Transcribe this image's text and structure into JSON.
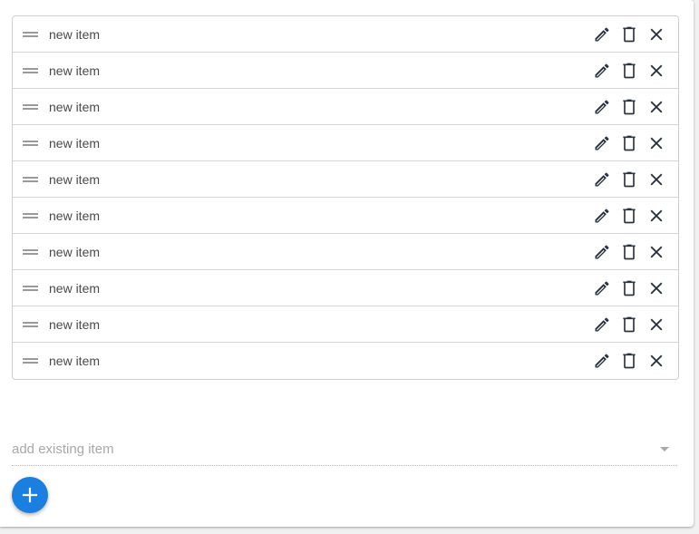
{
  "list": {
    "items": [
      {
        "label": "new item"
      },
      {
        "label": "new item"
      },
      {
        "label": "new item"
      },
      {
        "label": "new item"
      },
      {
        "label": "new item"
      },
      {
        "label": "new item"
      },
      {
        "label": "new item"
      },
      {
        "label": "new item"
      },
      {
        "label": "new item"
      },
      {
        "label": "new item"
      }
    ],
    "action_icons": [
      "pencil-icon",
      "trash-icon",
      "close-icon"
    ],
    "icon_color": "#2b3442"
  },
  "select": {
    "placeholder": "add existing item"
  },
  "fab": {
    "icon": "plus-icon",
    "color": "#1a7fe0"
  }
}
